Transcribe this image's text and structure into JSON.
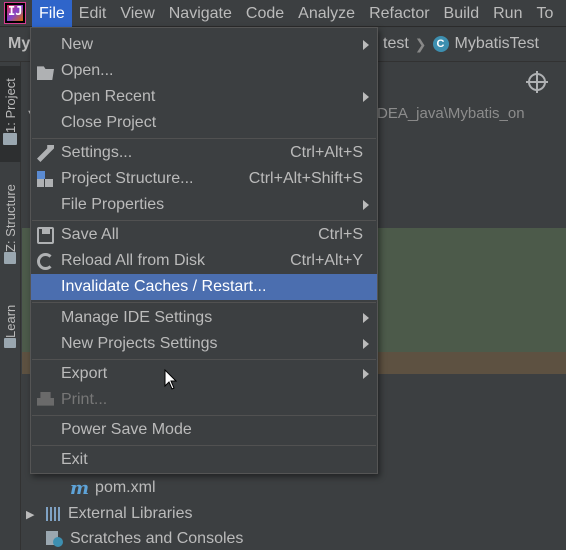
{
  "menubar": {
    "logo": "IJ",
    "items": [
      "File",
      "Edit",
      "View",
      "Navigate",
      "Code",
      "Analyze",
      "Refactor",
      "Build",
      "Run",
      "To"
    ],
    "mnemonics": [
      "F",
      "E",
      "V",
      "N",
      "C",
      "",
      "R",
      "B",
      "u",
      "T"
    ],
    "active_index": 0
  },
  "breadcrumb": {
    "left": "My",
    "segments": [
      "test",
      "MybatisTest"
    ],
    "class_badge": "C"
  },
  "tool_windows": {
    "project_tab": "1: Project",
    "structure_tab": "Z: Structure",
    "learn_tab": "Learn"
  },
  "project_panel": {
    "path_fragment": "DEA_java\\Mybatis_on",
    "tree": {
      "pom_icon": "m",
      "pom": "pom.xml",
      "external_libraries": "External Libraries",
      "scratches": "Scratches and Consoles"
    }
  },
  "file_menu": {
    "items": [
      {
        "label": "New",
        "shortcut": "",
        "submenu": true,
        "icon": ""
      },
      {
        "label": "Open...",
        "shortcut": "",
        "submenu": false,
        "icon": "folder-icon"
      },
      {
        "label": "Open Recent",
        "shortcut": "",
        "submenu": true,
        "icon": ""
      },
      {
        "label": "Close Project",
        "shortcut": "",
        "submenu": false,
        "icon": ""
      },
      {
        "label": "Settings...",
        "shortcut": "Ctrl+Alt+S",
        "submenu": false,
        "icon": "wrench-icon"
      },
      {
        "label": "Project Structure...",
        "shortcut": "Ctrl+Alt+Shift+S",
        "submenu": false,
        "icon": "project-structure-icon"
      },
      {
        "label": "File Properties",
        "shortcut": "",
        "submenu": true,
        "icon": ""
      },
      {
        "label": "Save All",
        "shortcut": "Ctrl+S",
        "submenu": false,
        "icon": "save-icon"
      },
      {
        "label": "Reload All from Disk",
        "shortcut": "Ctrl+Alt+Y",
        "submenu": false,
        "icon": "reload-icon"
      },
      {
        "label": "Invalidate Caches / Restart...",
        "shortcut": "",
        "submenu": false,
        "icon": "",
        "highlighted": true
      },
      {
        "label": "Manage IDE Settings",
        "shortcut": "",
        "submenu": true,
        "icon": ""
      },
      {
        "label": "New Projects Settings",
        "shortcut": "",
        "submenu": true,
        "icon": ""
      },
      {
        "label": "Export",
        "shortcut": "",
        "submenu": true,
        "icon": ""
      },
      {
        "label": "Print...",
        "shortcut": "",
        "submenu": false,
        "icon": "print-icon",
        "disabled": true
      },
      {
        "label": "Power Save Mode",
        "shortcut": "",
        "submenu": false,
        "icon": ""
      },
      {
        "label": "Exit",
        "shortcut": "",
        "submenu": false,
        "icon": ""
      }
    ]
  },
  "colors": {
    "background": "#3c3f41",
    "menu_active": "#2f65ca",
    "menu_highlight": "#4b6eaf",
    "text": "#bbbbbb",
    "disabled_text": "#777777"
  }
}
